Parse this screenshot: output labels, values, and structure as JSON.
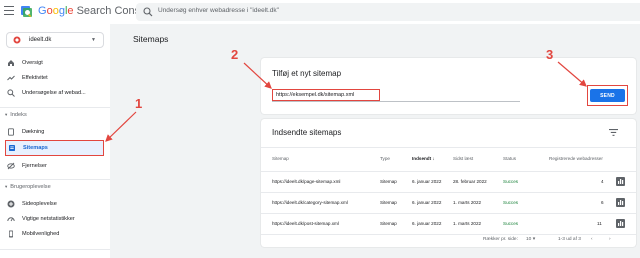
{
  "header": {
    "brand": [
      "G",
      "o",
      "o",
      "g",
      "l",
      "e"
    ],
    "brand_rest": " Search Console",
    "search_placeholder": "Undersøg enhver webadresse i \"ideelt.dk\""
  },
  "property": {
    "label": "ideelt.dk"
  },
  "sidebar": {
    "items_top": [
      {
        "label": "Oversigt",
        "icon": "home-icon"
      },
      {
        "label": "Effektivitet",
        "icon": "trend-icon"
      },
      {
        "label": "Undersøgelse af webad...",
        "icon": "search-icon"
      }
    ],
    "section_index": "Indeks",
    "items_index": [
      {
        "label": "Dækning",
        "icon": "file-icon"
      },
      {
        "label": "Sitemaps",
        "icon": "sitemap-icon"
      },
      {
        "label": "Fjernelser",
        "icon": "removals-icon"
      }
    ],
    "section_experience": "Brugeroplevelse",
    "items_experience": [
      {
        "label": "Sideoplevelse",
        "icon": "plus-circle-icon"
      },
      {
        "label": "Vigtige netstatistikker",
        "icon": "speed-icon"
      },
      {
        "label": "Mobilvenlighed",
        "icon": "phone-icon"
      }
    ]
  },
  "main": {
    "title": "Sitemaps",
    "add": {
      "title": "Tilføj et nyt sitemap",
      "input_value": "https://eksempel.dk/sitemap.xml",
      "send_label": "SEND"
    },
    "list": {
      "title": "Indsendte sitemaps",
      "columns": [
        "Sitemap",
        "Type",
        "Indsendt",
        "Sidst læst",
        "Status",
        "Registrerede webadresser"
      ],
      "rows": [
        {
          "sitemap": "https://ideelt.dk/page-sitemap.xml",
          "type": "Sitemap",
          "submitted": "6. januar 2022",
          "last_read": "28. februar 2022",
          "status": "Succes",
          "urls": "4"
        },
        {
          "sitemap": "https://ideelt.dk/category-sitemap.xml",
          "type": "Sitemap",
          "submitted": "6. januar 2022",
          "last_read": "1. marts 2022",
          "status": "Succes",
          "urls": "6"
        },
        {
          "sitemap": "https://ideelt.dk/post-sitemap.xml",
          "type": "Sitemap",
          "submitted": "6. januar 2022",
          "last_read": "1. marts 2022",
          "status": "Succes",
          "urls": "11"
        }
      ],
      "rows_per_page_label": "Rækker pr. side:",
      "rows_per_page": "10",
      "range": "1-3 ud af 3"
    }
  },
  "annotations": [
    "1",
    "2",
    "3"
  ],
  "colors": {
    "accent": "#1a73e8",
    "annotation": "#e2463f",
    "success": "#188038"
  }
}
